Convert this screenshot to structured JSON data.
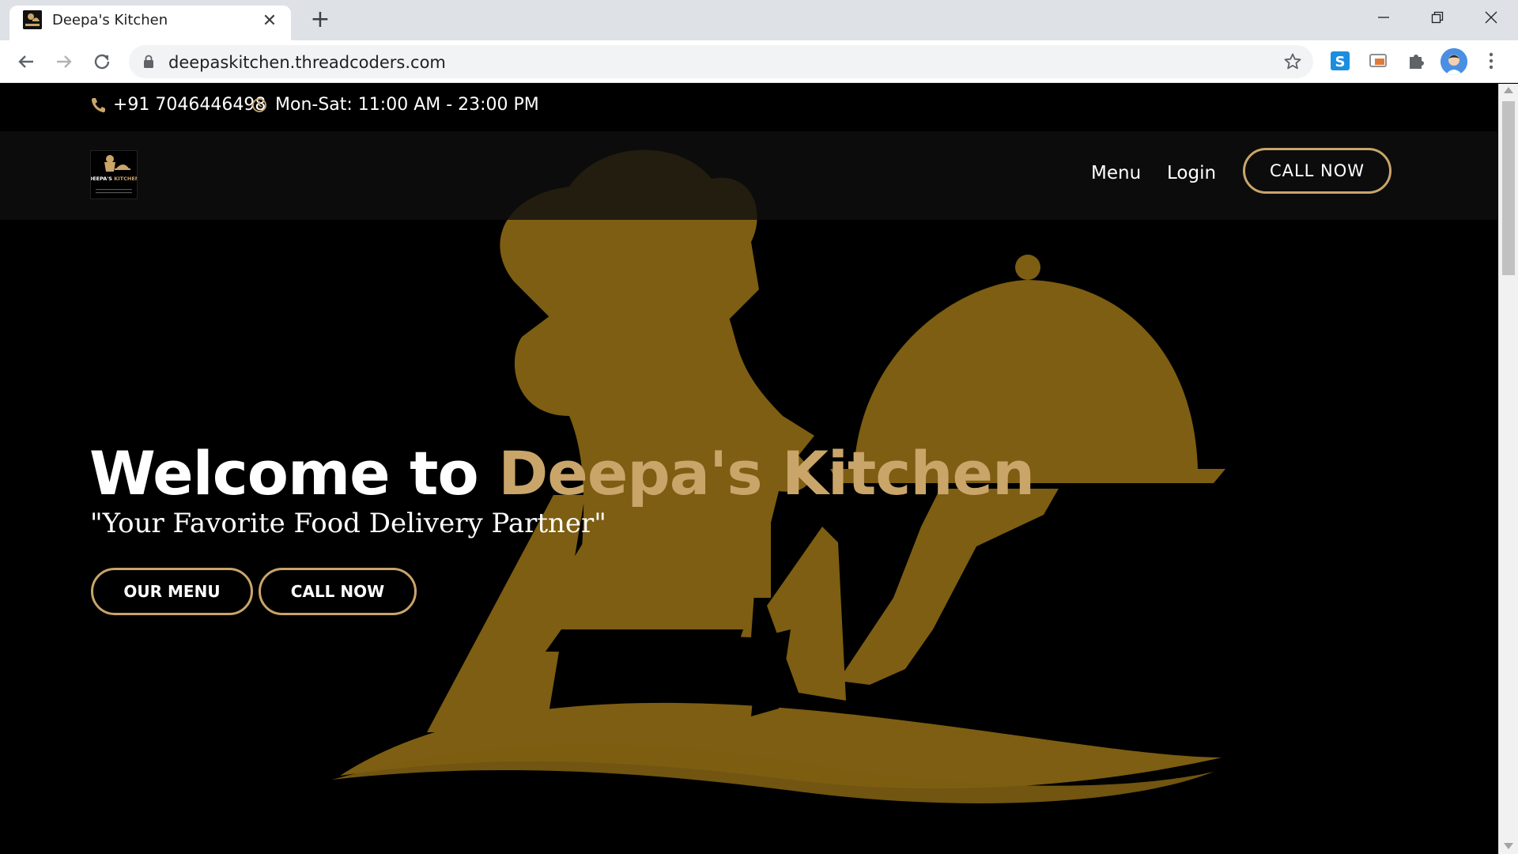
{
  "browser": {
    "tab_title": "Deepa's Kitchen",
    "tab_close": "✕",
    "new_tab": "+",
    "url": "deepaskitchen.threadcoders.com"
  },
  "topbar": {
    "phone": "+91 7046446498",
    "hours": "Mon-Sat: 11:00 AM - 23:00 PM"
  },
  "navbar": {
    "logo_text": "DEEPA'S KITCHEN",
    "menu_label": "Menu",
    "login_label": "Login",
    "call_label": "CALL NOW"
  },
  "hero": {
    "title_prefix": "Welcome to ",
    "title_accent": "Deepa's Kitchen",
    "tagline": "\"Your Favorite Food Delivery Partner\"",
    "menu_button": "OUR MENU",
    "call_button": "CALL NOW"
  },
  "colors": {
    "accent": "#c9a56a",
    "art": "#7d5e12",
    "background": "#000000"
  },
  "icons": {
    "phone": "phone-icon",
    "clock": "clock-icon",
    "lock": "lock-icon",
    "star": "star-icon"
  }
}
